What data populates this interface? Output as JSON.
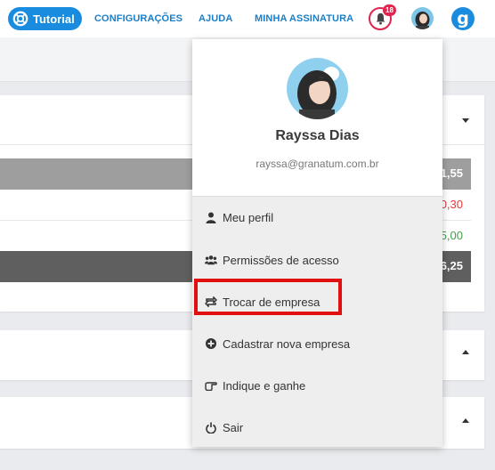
{
  "nav": {
    "tutorial_label": "Tutorial",
    "links": [
      "CONFIGURAÇÕES",
      "AJUDA",
      "MINHA ASSINATURA"
    ],
    "notification_count": "18",
    "logo_letter": "g"
  },
  "background": {
    "row_values": [
      "1,55",
      "0,30",
      "5,00",
      "6,25"
    ],
    "row_colors": [
      "#ffffff",
      "#e53935",
      "#43a047",
      "#ffffff"
    ]
  },
  "profile": {
    "name": "Rayssa Dias",
    "email": "rayssa@granatum.com.br"
  },
  "menu": {
    "items": [
      {
        "label": "Meu perfil",
        "icon": "user-icon"
      },
      {
        "label": "Permissões de acesso",
        "icon": "users-icon"
      },
      {
        "label": "Trocar de empresa",
        "icon": "swap-icon"
      },
      {
        "label": "Cadastrar nova empresa",
        "icon": "plus-circle-icon"
      },
      {
        "label": "Indique e ganhe",
        "icon": "hand-point-icon"
      },
      {
        "label": "Sair",
        "icon": "power-icon"
      }
    ]
  },
  "colors": {
    "accent": "#1a8ce0",
    "notification": "#e0244f",
    "highlight": "#e01010"
  }
}
